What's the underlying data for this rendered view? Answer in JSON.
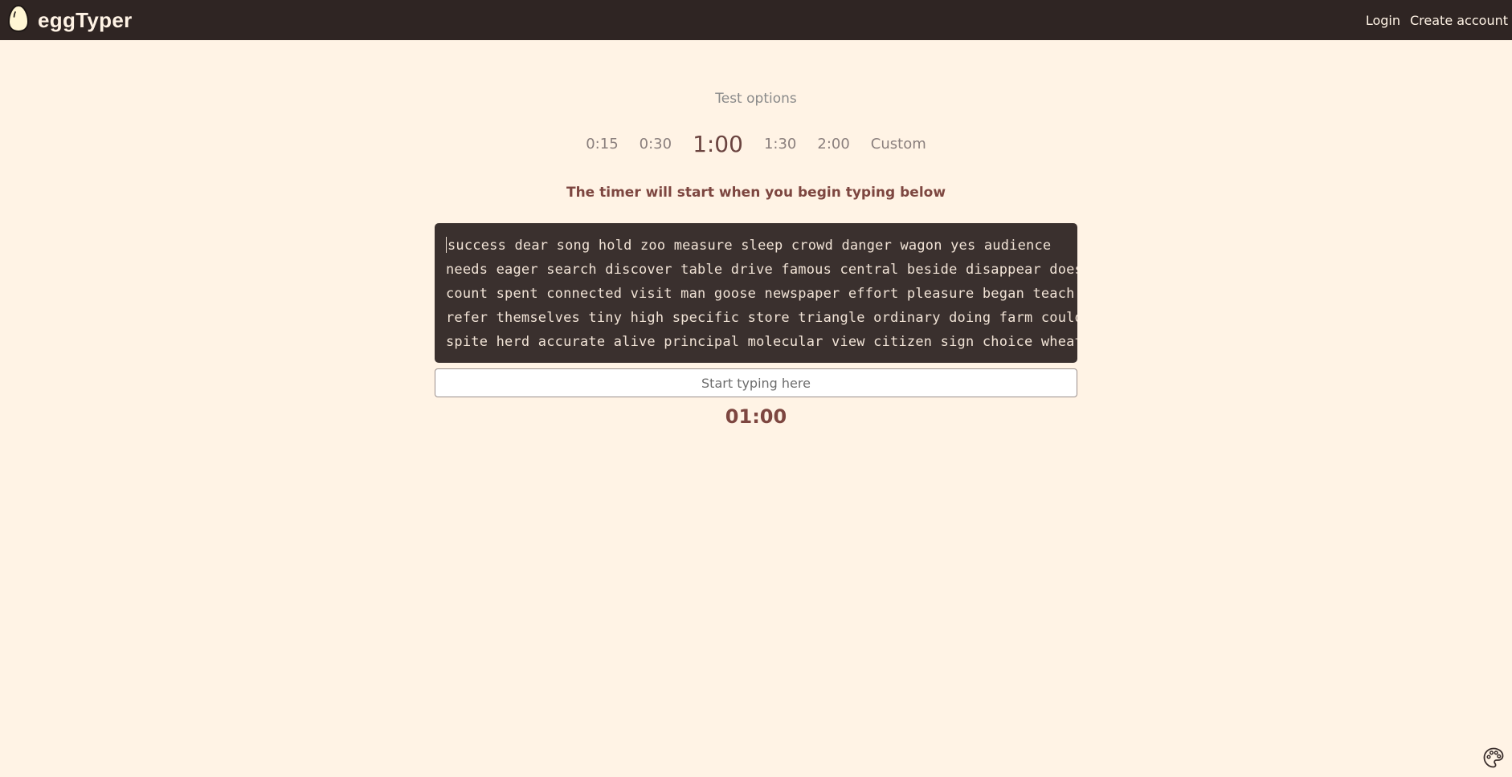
{
  "navbar": {
    "brand": "eggTyper",
    "logo_icon": "egg-icon",
    "login": "Login",
    "create_account": "Create account"
  },
  "options": {
    "title": "Test options",
    "durations": [
      "0:15",
      "0:30",
      "1:00",
      "1:30",
      "2:00",
      "Custom"
    ],
    "selected": "1:00"
  },
  "timer_hint": "The timer will start when you begin typing below",
  "words": {
    "lines": [
      "success dear song hold zoo measure sleep crowd danger wagon yes audience",
      "needs eager search discover table drive famous central beside disappear does",
      "count spent connected visit man goose newspaper effort pleasure began teach",
      "refer themselves tiny high specific store triangle ordinary doing farm could",
      "spite herd accurate alive principal molecular view citizen sign choice wheat"
    ]
  },
  "input": {
    "placeholder": "Start typing here",
    "value": ""
  },
  "countdown": "01:00",
  "theme_button_icon": "palette-icon",
  "colors": {
    "navbar_bg": "#2f2523",
    "page_bg": "#fff3e5",
    "accent": "#7d4640",
    "word_box_bg": "#3a302e"
  }
}
